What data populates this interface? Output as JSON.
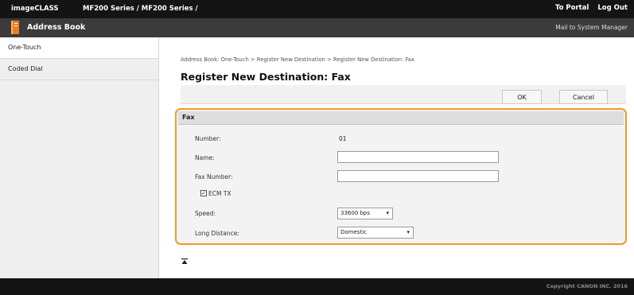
{
  "header": {
    "brand": "imageCLASS",
    "model": "MF200 Series / MF200 Series /",
    "portal_link": "To Portal",
    "logout_link": "Log Out",
    "app_title": "Address Book",
    "mail_link": "Mail to System Manager"
  },
  "sidebar": {
    "items": [
      {
        "label": "One-Touch"
      },
      {
        "label": "Coded Dial"
      }
    ]
  },
  "main": {
    "breadcrumb": "Address Book: One-Touch > Register New Destination > Register New Destination: Fax",
    "title": "Register New Destination: Fax",
    "ok_label": "OK",
    "cancel_label": "Cancel"
  },
  "form": {
    "section_title": "Fax",
    "number_label": "Number:",
    "number_value": "01",
    "name_label": "Name:",
    "name_value": "",
    "fax_number_label": "Fax Number:",
    "fax_number_value": "",
    "ecm_label": "ECM TX",
    "ecm_checked": true,
    "speed_label": "Speed:",
    "speed_value": "33600 bps",
    "long_distance_label": "Long Distance:",
    "long_distance_value": "Domestic"
  },
  "footer": {
    "copyright": "Copyright CANON INC. 2016"
  },
  "colors": {
    "accent": "#f09a2a",
    "topbar": "#141414",
    "titlebar": "#3b3b3b"
  },
  "icons": {
    "app": "address-book-icon",
    "page_top": "page-top-icon"
  }
}
